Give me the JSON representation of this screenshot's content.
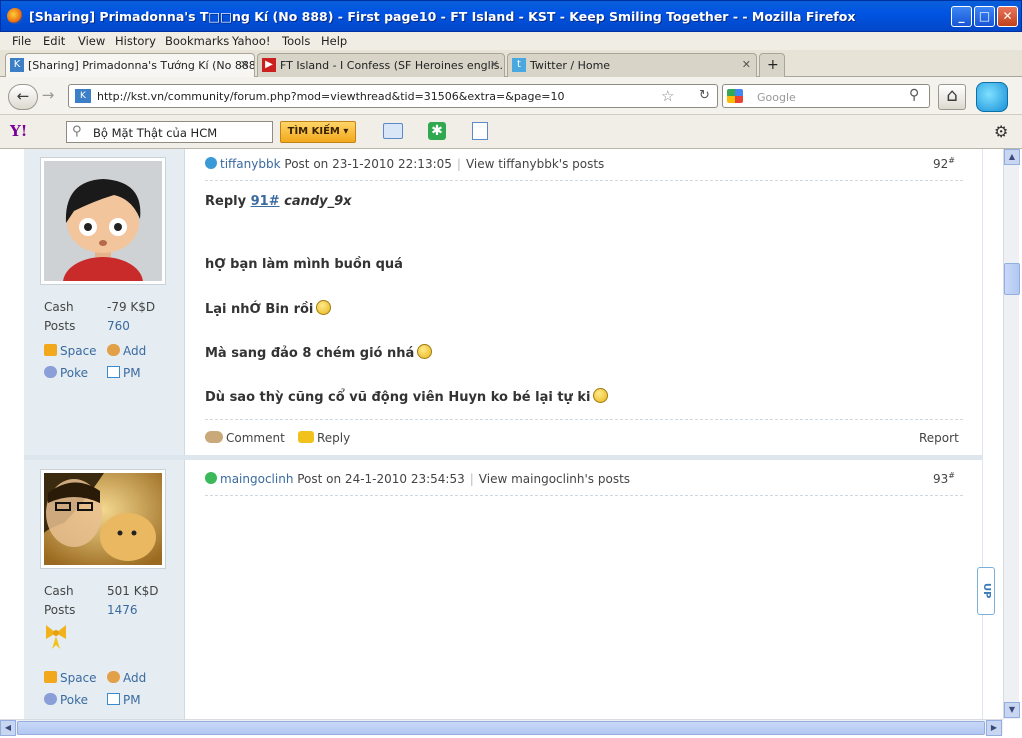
{
  "window": {
    "title": "[Sharing] Primadonna's T□□ng Kí (No 888) - First page10 - FT Island - KST - Keep Smiling Together - - Mozilla Firefox",
    "min": "_",
    "max": "□",
    "close": "✕"
  },
  "menu": [
    "File",
    "Edit",
    "View",
    "History",
    "Bookmarks",
    "Yahoo!",
    "Tools",
    "Help"
  ],
  "tabs": [
    {
      "label": "[Sharing] Primadonna's Tướng Kí (No 888...",
      "close": "✕"
    },
    {
      "label": "FT Island - I Confess (SF Heroines englis...",
      "close": "✕"
    },
    {
      "label": "Twitter / Home",
      "close": "✕"
    }
  ],
  "new_tab": "+",
  "nav": {
    "url": "http://kst.vn/community/forum.php?mod=viewthread&tid=31506&extra=&page=10",
    "search_placeholder": "Google",
    "back": "←",
    "forward": "→",
    "reload": "↻",
    "home": "⌂",
    "star": "☆",
    "magnifier": "⚲"
  },
  "yahoo": {
    "logo": "Y!",
    "query": "Bộ Mặt Thật của HCM",
    "search_button": "TÌM KIẾM ▾"
  },
  "posts": [
    {
      "author": "tiffanybbk",
      "post_on": "Post on 23-1-2010 22:13:05",
      "view_link": "View tiffanybbk's posts",
      "number": "92",
      "number_sup": "#",
      "cash_label": "Cash",
      "cash_value": "-79 K$D",
      "posts_label": "Posts",
      "posts_value": "760",
      "reply_prefix": "Reply",
      "reply_ref": "91#",
      "reply_to": "candy_9x",
      "lines": [
        "hỢ bạn làm mình buồn quá",
        "Lại nhỚ Bin rồi",
        "Mà sang đảo 8 chém gió nhá",
        "Dù sao thỳ cũng cổ vũ động viên Huyn ko bé lại tự ki"
      ],
      "comment": "Comment",
      "reply": "Reply",
      "report": "Report"
    },
    {
      "author": "maingoclinh",
      "post_on": "Post on 24-1-2010 23:54:53",
      "view_link": "View maingoclinh's posts",
      "number": "93",
      "number_sup": "#",
      "cash_label": "Cash",
      "cash_value": "501 K$D",
      "posts_label": "Posts",
      "posts_value": "1476"
    }
  ],
  "user_links": {
    "space": "Space",
    "add": "Add",
    "poke": "Poke",
    "pm": "PM"
  },
  "up_button": "UP",
  "colors": {
    "title_bar": "#0054e3",
    "link": "#3a6aa0",
    "sidebar": "#e5edf2",
    "yahoo_button": "#f2a81c"
  }
}
